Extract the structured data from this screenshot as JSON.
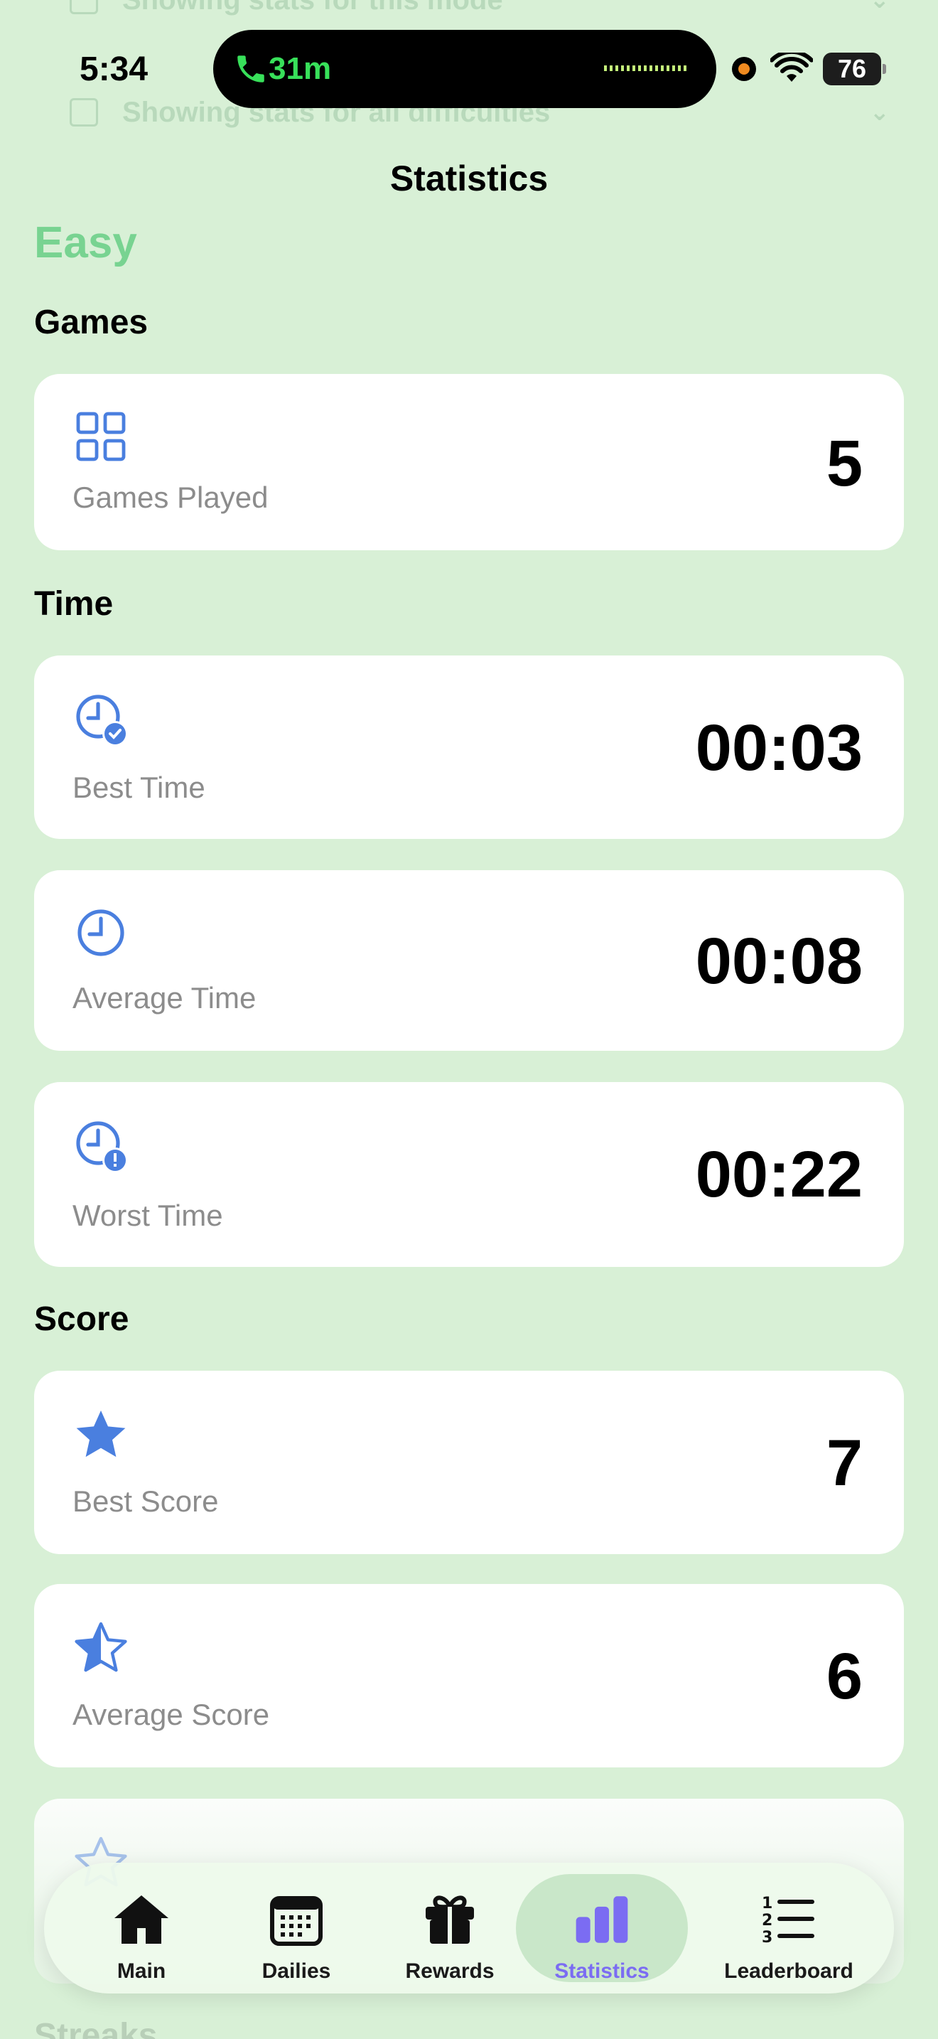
{
  "background_rows": [
    {
      "label": "Showing stats for this mode"
    },
    {
      "label": "Showing stats for all difficulties"
    }
  ],
  "status": {
    "time": "5:34",
    "call_duration": "31m",
    "battery": "76"
  },
  "header": {
    "title": "Statistics"
  },
  "difficulty_label": "Easy",
  "sections": {
    "games": "Games",
    "time": "Time",
    "score": "Score",
    "streaks": "Streaks"
  },
  "stats": {
    "games_played": {
      "label": "Games Played",
      "value": "5",
      "icon": "grid-icon"
    },
    "best_time": {
      "label": "Best Time",
      "value": "00:03",
      "icon": "clock-check-icon"
    },
    "average_time": {
      "label": "Average Time",
      "value": "00:08",
      "icon": "clock-icon"
    },
    "worst_time": {
      "label": "Worst Time",
      "value": "00:22",
      "icon": "clock-alert-icon"
    },
    "best_score": {
      "label": "Best Score",
      "value": "7",
      "icon": "star-filled-icon"
    },
    "average_score": {
      "label": "Average Score",
      "value": "6",
      "icon": "star-half-icon"
    }
  },
  "tabbar": {
    "items": [
      {
        "label": "Main",
        "icon": "house-icon"
      },
      {
        "label": "Dailies",
        "icon": "calendar-icon"
      },
      {
        "label": "Rewards",
        "icon": "gift-icon"
      },
      {
        "label": "Statistics",
        "icon": "bar-chart-icon"
      },
      {
        "label": "Leaderboard",
        "icon": "ranked-list-icon"
      }
    ],
    "active": "Statistics"
  },
  "colors": {
    "background": "#d8f0d6",
    "accent_icon": "#4a7fdf",
    "active_tab": "#7b6cf2",
    "difficulty": "#68cf86",
    "call_green": "#38e05a"
  }
}
